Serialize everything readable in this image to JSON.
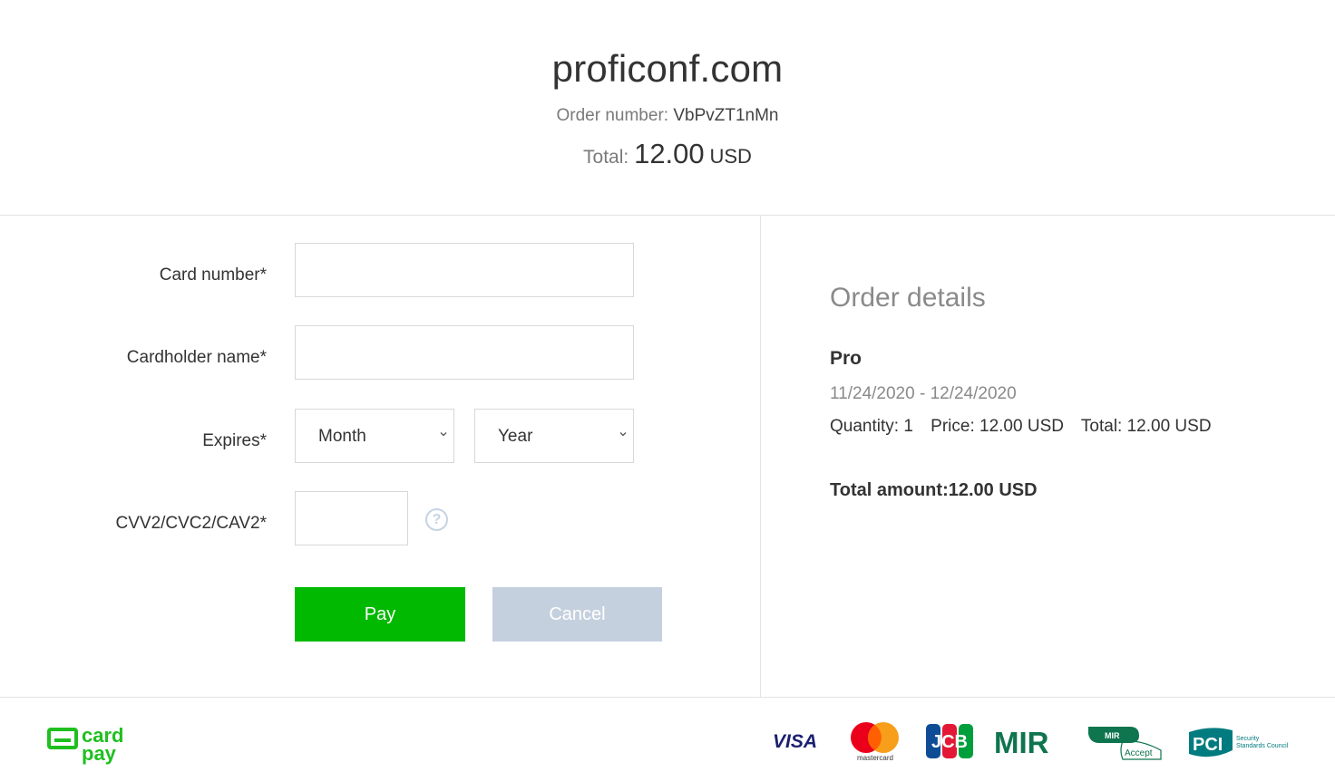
{
  "header": {
    "site_name": "proficonf.com",
    "order_label": "Order number:",
    "order_number": "VbPvZT1nMn",
    "total_label": "Total:",
    "total_amount": "12.00",
    "total_currency": "USD"
  },
  "form": {
    "card_number_label": "Card number*",
    "cardholder_label": "Cardholder name*",
    "expires_label": "Expires*",
    "month_value": "Month",
    "year_value": "Year",
    "cvv_label": "CVV2/CVC2/CAV2*",
    "help_glyph": "?",
    "pay_label": "Pay",
    "cancel_label": "Cancel"
  },
  "order_details": {
    "title": "Order details",
    "plan": "Pro",
    "dates": "11/24/2020 - 12/24/2020",
    "quantity": "Quantity: 1",
    "price": "Price: 12.00 USD",
    "line_total": "Total: 12.00 USD",
    "total_amount": "Total amount:12.00 USD"
  },
  "footer": {
    "brand_top": "card",
    "brand_bottom": "pay",
    "visa": "VISA",
    "mastercard": "mastercard",
    "jcb": "JCB",
    "mir": "MIR",
    "mir_accept_top": "MIR",
    "mir_accept_bottom": "Accept",
    "pci": "PCI",
    "pci_sub1": "Security",
    "pci_sub2": "Standards Council"
  },
  "colors": {
    "pay_green": "#00b900",
    "cancel_gray": "#c5d0de",
    "brand_green": "#1fbf1f",
    "mir_green": "#0f754e"
  },
  "icons": [
    "help-icon",
    "chevron-down-icon"
  ]
}
